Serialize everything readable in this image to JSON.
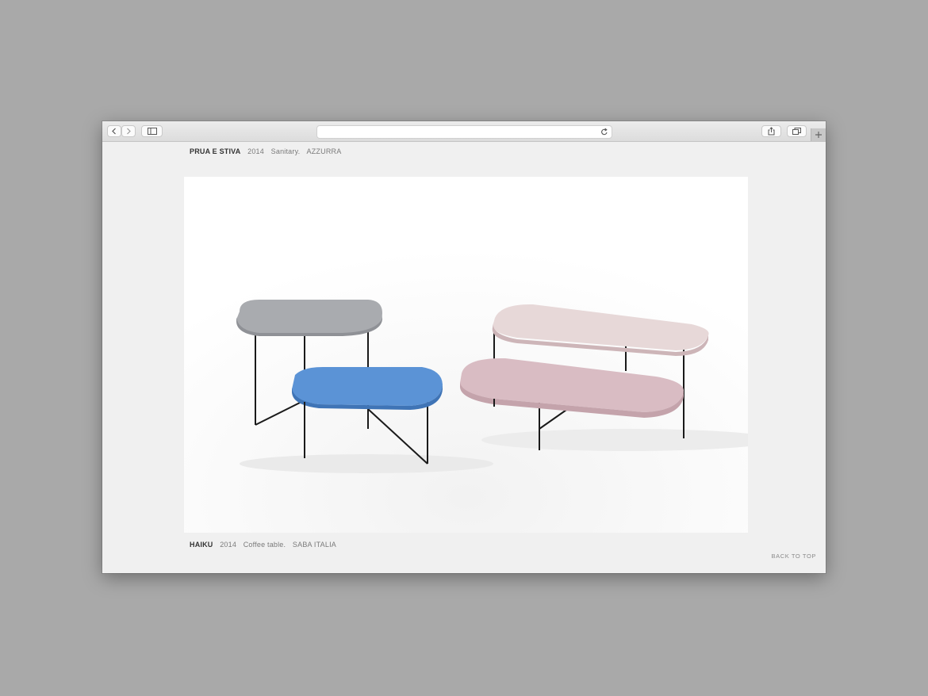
{
  "browser": {
    "back_icon": "chevron-left-icon",
    "forward_icon": "chevron-right-icon",
    "sidebar_icon": "sidebar-icon",
    "reload_icon": "reload-icon",
    "share_icon": "share-icon",
    "tabs_icon": "tabs-overview-icon",
    "new_tab_icon": "plus-icon",
    "address": ""
  },
  "projects": [
    {
      "name": "PRUA E STIVA",
      "year": "2014",
      "type": "Sanitary.",
      "client": "AZZURRA"
    },
    {
      "name": "HAIKU",
      "year": "2014",
      "type": "Coffee table.",
      "client": "SABA ITALIA"
    }
  ],
  "footer": {
    "back_to_top": "BACK TO TOP"
  },
  "colors": {
    "page_bg": "#f0f0f0",
    "grey_top": "#a9abaf",
    "blue_shelf": "#5b93d6",
    "pink_top": "#e7d8d8",
    "pink_shelf": "#d9bcc3",
    "legs": "#1a1a1a"
  }
}
